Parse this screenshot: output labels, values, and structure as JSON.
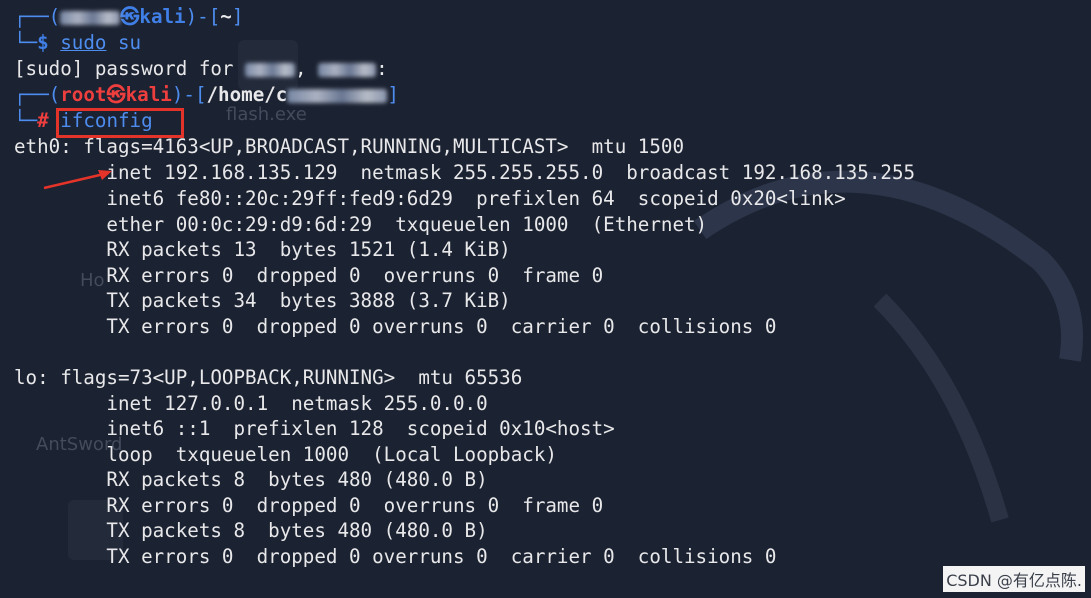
{
  "terminal": {
    "prompt1": {
      "corner_top": "┌──(",
      "at_icon": "㉿",
      "host": "kali",
      "cwd_open": ")-[",
      "cwd": "~",
      "cwd_close": "]",
      "corner_bottom": "└─",
      "symbol": "$",
      "command_sudo": "sudo",
      "command_rest": " su"
    },
    "sudo_prompt": {
      "prefix": "[sudo] password for ",
      "separator": ",",
      "suffix": ":"
    },
    "prompt2": {
      "corner_top": "┌──(",
      "user": "root",
      "at_icon": "㉿",
      "host": "kali",
      "cwd_open": ")-[",
      "cwd": "/home/c",
      "cwd_close": "]",
      "corner_bottom": "└─",
      "symbol": "#",
      "command": "ifconfig"
    },
    "output_lines": [
      "eth0: flags=4163<UP,BROADCAST,RUNNING,MULTICAST>  mtu 1500",
      "        inet 192.168.135.129  netmask 255.255.255.0  broadcast 192.168.135.255",
      "        inet6 fe80::20c:29ff:fed9:6d29  prefixlen 64  scopeid 0x20<link>",
      "        ether 00:0c:29:d9:6d:29  txqueuelen 1000  (Ethernet)",
      "        RX packets 13  bytes 1521 (1.4 KiB)",
      "        RX errors 0  dropped 0  overruns 0  frame 0",
      "        TX packets 34  bytes 3888 (3.7 KiB)",
      "        TX errors 0  dropped 0 overruns 0  carrier 0  collisions 0",
      "",
      "lo: flags=73<UP,LOOPBACK,RUNNING>  mtu 65536",
      "        inet 127.0.0.1  netmask 255.0.0.0",
      "        inet6 ::1  prefixlen 128  scopeid 0x10<host>",
      "        loop  txqueuelen 1000  (Local Loopback)",
      "        RX packets 8  bytes 480 (480.0 B)",
      "        RX errors 0  dropped 0  overruns 0  frame 0",
      "        TX packets 8  bytes 480 (480.0 B)",
      "        TX errors 0  dropped 0 overruns 0  carrier 0  collisions 0"
    ]
  },
  "desktop_ghosts": {
    "file1": "flash.exe",
    "file2": "Ho",
    "file3": "AntSword"
  },
  "watermark": "CSDN @有亿点陈.",
  "colors": {
    "background": "#1b2231",
    "prompt_blue": "#4e8df0",
    "root_red": "#ee3e3e",
    "highlight_box": "#e4342a",
    "arrow": "#e4342a"
  }
}
